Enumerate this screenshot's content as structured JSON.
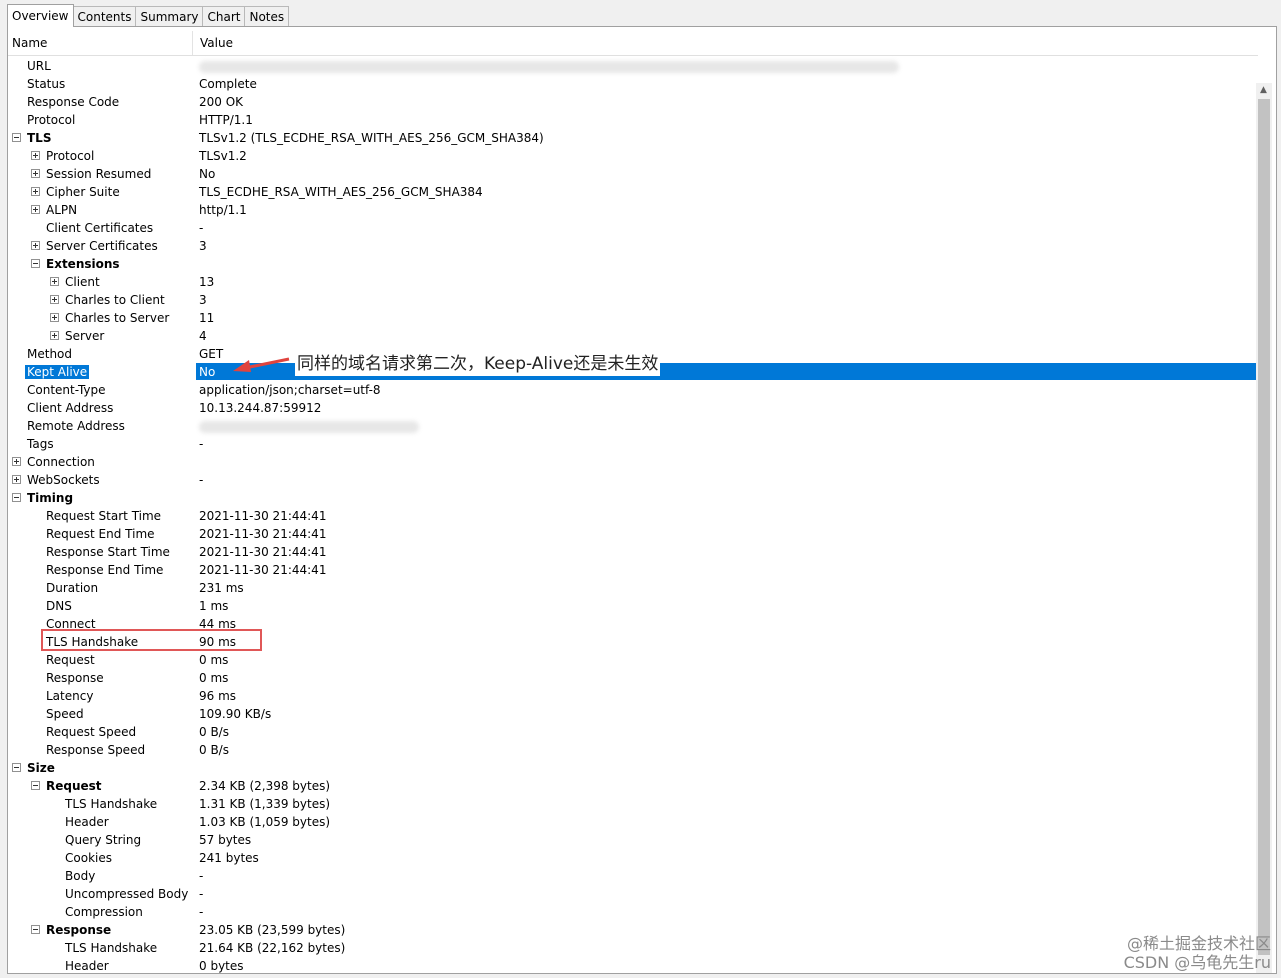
{
  "tabs": [
    "Overview",
    "Contents",
    "Summary",
    "Chart",
    "Notes"
  ],
  "columns": {
    "name": "Name",
    "value": "Value"
  },
  "rows": [
    {
      "name": "URL",
      "value": "",
      "level": 1,
      "blur": 700
    },
    {
      "name": "Status",
      "value": "Complete",
      "level": 1
    },
    {
      "name": "Response Code",
      "value": "200 OK",
      "level": 1
    },
    {
      "name": "Protocol",
      "value": "HTTP/1.1",
      "level": 1
    },
    {
      "name": "TLS",
      "value": "TLSv1.2 (TLS_ECDHE_RSA_WITH_AES_256_GCM_SHA384)",
      "level": 0,
      "exp": "minus",
      "bold": true
    },
    {
      "name": "Protocol",
      "value": "TLSv1.2",
      "level": 1,
      "exp": "plus"
    },
    {
      "name": "Session Resumed",
      "value": "No",
      "level": 1,
      "exp": "plus"
    },
    {
      "name": "Cipher Suite",
      "value": "TLS_ECDHE_RSA_WITH_AES_256_GCM_SHA384",
      "level": 1,
      "exp": "plus"
    },
    {
      "name": "ALPN",
      "value": "http/1.1",
      "level": 1,
      "exp": "plus"
    },
    {
      "name": "Client Certificates",
      "value": "-",
      "level": 2
    },
    {
      "name": "Server Certificates",
      "value": "3",
      "level": 1,
      "exp": "plus"
    },
    {
      "name": "Extensions",
      "value": "",
      "level": 1,
      "exp": "minus",
      "bold": true
    },
    {
      "name": "Client",
      "value": "13",
      "level": 2,
      "exp": "plus"
    },
    {
      "name": "Charles to Client",
      "value": "3",
      "level": 2,
      "exp": "plus"
    },
    {
      "name": "Charles to Server",
      "value": "11",
      "level": 2,
      "exp": "plus"
    },
    {
      "name": "Server",
      "value": "4",
      "level": 2,
      "exp": "plus"
    },
    {
      "name": "Method",
      "value": "GET",
      "level": 1
    },
    {
      "name": "Kept Alive",
      "value": "No",
      "level": 1,
      "selected": true
    },
    {
      "name": "Content-Type",
      "value": "application/json;charset=utf-8",
      "level": 1
    },
    {
      "name": "Client Address",
      "value": "10.13.244.87:59912",
      "level": 1
    },
    {
      "name": "Remote Address",
      "value": "",
      "level": 1,
      "blur": 220
    },
    {
      "name": "Tags",
      "value": "-",
      "level": 1
    },
    {
      "name": "Connection",
      "value": "",
      "level": 0,
      "exp": "plus"
    },
    {
      "name": "WebSockets",
      "value": "-",
      "level": 0,
      "exp": "plus"
    },
    {
      "name": "Timing",
      "value": "",
      "level": 0,
      "exp": "minus",
      "bold": true
    },
    {
      "name": "Request Start Time",
      "value": "2021-11-30 21:44:41",
      "level": 2
    },
    {
      "name": "Request End Time",
      "value": "2021-11-30 21:44:41",
      "level": 2
    },
    {
      "name": "Response Start Time",
      "value": "2021-11-30 21:44:41",
      "level": 2
    },
    {
      "name": "Response End Time",
      "value": "2021-11-30 21:44:41",
      "level": 2
    },
    {
      "name": "Duration",
      "value": "231 ms",
      "level": 2
    },
    {
      "name": "DNS",
      "value": "1 ms",
      "level": 2
    },
    {
      "name": "Connect",
      "value": "44 ms",
      "level": 2
    },
    {
      "name": "TLS Handshake",
      "value": "90 ms",
      "level": 2
    },
    {
      "name": "Request",
      "value": "0 ms",
      "level": 2
    },
    {
      "name": "Response",
      "value": "0 ms",
      "level": 2
    },
    {
      "name": "Latency",
      "value": "96 ms",
      "level": 2
    },
    {
      "name": "Speed",
      "value": "109.90 KB/s",
      "level": 2
    },
    {
      "name": "Request Speed",
      "value": "0 B/s",
      "level": 2
    },
    {
      "name": "Response Speed",
      "value": "0 B/s",
      "level": 2
    },
    {
      "name": "Size",
      "value": "",
      "level": 0,
      "exp": "minus",
      "bold": true
    },
    {
      "name": "Request",
      "value": "2.34 KB (2,398 bytes)",
      "level": 1,
      "exp": "minus",
      "bold": true
    },
    {
      "name": "TLS Handshake",
      "value": "1.31 KB (1,339 bytes)",
      "level": 3
    },
    {
      "name": "Header",
      "value": "1.03 KB (1,059 bytes)",
      "level": 3
    },
    {
      "name": "Query String",
      "value": "57 bytes",
      "level": 3
    },
    {
      "name": "Cookies",
      "value": "241 bytes",
      "level": 3
    },
    {
      "name": "Body",
      "value": "-",
      "level": 3
    },
    {
      "name": "Uncompressed Body",
      "value": "-",
      "level": 3
    },
    {
      "name": "Compression",
      "value": "-",
      "level": 3
    },
    {
      "name": "Response",
      "value": "23.05 KB (23,599 bytes)",
      "level": 1,
      "exp": "minus",
      "bold": true
    },
    {
      "name": "TLS Handshake",
      "value": "21.64 KB (22,162 bytes)",
      "level": 3
    },
    {
      "name": "Header",
      "value": "0 bytes",
      "level": 3
    }
  ],
  "annotation": {
    "text_a": "同样的域名请求第二次，",
    "text_b": "Keep-Alive",
    "text_c": "还是未生效"
  },
  "watermark": {
    "line1": "@稀土掘金技术社区",
    "line2": "CSDN @乌龟先生ru"
  },
  "colors": {
    "selection": "#0078d7",
    "highlight_box": "#e05757"
  }
}
